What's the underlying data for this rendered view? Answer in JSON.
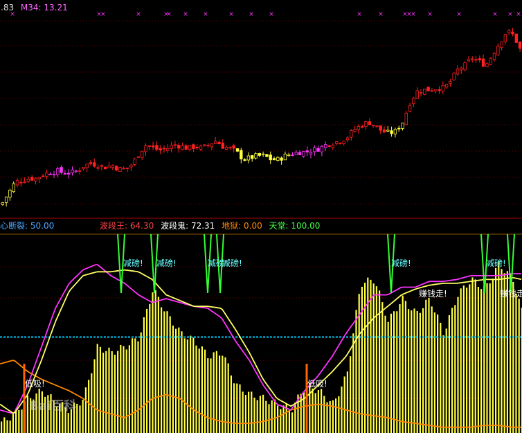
{
  "header_top": {
    "price_tail": ".83",
    "ma_label": "M34: 13.21"
  },
  "indicator_header": {
    "left_tail": "心断裂: 50.00",
    "items": [
      {
        "label": "波段王: 64.30",
        "color": "#ff4444"
      },
      {
        "label": "波段鬼: 72.31",
        "color": "#ffffff"
      },
      {
        "label": "地狱: 0.00",
        "color": "#ff8800"
      },
      {
        "label": "天堂: 100.00",
        "color": "#44ff44"
      }
    ],
    "left_color": "#4aa8ff"
  },
  "annotations": {
    "sell": "减磅!",
    "buy": "低吸!",
    "hold": "赚钱走!"
  },
  "watermark": "Bai百科",
  "colors": {
    "up": "#ff2020",
    "down": "#ff2020",
    "yellow": "#ffff40",
    "magenta": "#ff33ff",
    "orange": "#ff8800",
    "green": "#33ff33",
    "cyan": "#00ccff",
    "grid": "#7a0000"
  },
  "chart_data": [
    {
      "type": "candlestick",
      "ma_label": "M34: 13.21",
      "cross_markers_x": [
        18,
        143,
        149,
        200,
        240,
        244,
        268,
        297,
        334,
        363,
        392,
        519,
        550,
        585,
        591,
        597,
        621,
        663,
        715,
        737,
        749
      ],
      "close_series_x": [
        0,
        10,
        20,
        30,
        40,
        50,
        60,
        70,
        80,
        90,
        100,
        110,
        120,
        130,
        140,
        150,
        160,
        170,
        180,
        190,
        200,
        210,
        220,
        230,
        240,
        250,
        260,
        270,
        280,
        290,
        300,
        310,
        320,
        330,
        340,
        350,
        360,
        370,
        380,
        390,
        400,
        410,
        420,
        430,
        440,
        450,
        460,
        470,
        480,
        490,
        500,
        510,
        520,
        530,
        540,
        550,
        560,
        570,
        580,
        590,
        600,
        610,
        620,
        630,
        640,
        650,
        660,
        670,
        680,
        690,
        700,
        710,
        720,
        730,
        740,
        750
      ],
      "close_series_y": [
        9.9,
        10.2,
        10.5,
        10.55,
        10.6,
        10.6,
        10.7,
        10.75,
        10.8,
        10.75,
        10.75,
        10.8,
        10.95,
        11.0,
        10.95,
        10.9,
        10.95,
        10.85,
        10.85,
        11.0,
        11.3,
        11.5,
        11.4,
        11.35,
        11.4,
        11.5,
        11.45,
        11.4,
        11.45,
        11.4,
        11.5,
        11.6,
        11.45,
        11.4,
        11.3,
        11.1,
        11.15,
        11.2,
        11.2,
        11.1,
        11.1,
        11.2,
        11.25,
        11.3,
        11.3,
        11.35,
        11.4,
        11.5,
        11.55,
        11.6,
        11.7,
        11.9,
        12.0,
        12.1,
        12.0,
        11.85,
        11.8,
        11.85,
        12.1,
        12.6,
        12.9,
        12.95,
        12.95,
        13.0,
        13.0,
        13.2,
        13.5,
        13.6,
        13.8,
        13.7,
        13.6,
        13.9,
        14.2,
        14.5,
        14.4,
        14.0
      ]
    },
    {
      "type": "area",
      "series": [
        {
          "name": "波段王",
          "color": "magenta"
        },
        {
          "name": "波段鬼",
          "color": "yellow"
        },
        {
          "name": "地狱",
          "color": "orange"
        },
        {
          "name": "天堂",
          "color": "green"
        },
        {
          "name": "心断裂",
          "color": "cyan"
        }
      ],
      "ylim": [
        0,
        100
      ],
      "reference_line": 50,
      "x": [
        0,
        20,
        40,
        60,
        80,
        100,
        120,
        140,
        160,
        180,
        200,
        220,
        240,
        260,
        280,
        300,
        320,
        340,
        360,
        380,
        400,
        420,
        440,
        460,
        480,
        500,
        520,
        540,
        560,
        580,
        600,
        620,
        640,
        660,
        680,
        700,
        720,
        740,
        754
      ],
      "bars": [
        5,
        10,
        18,
        22,
        16,
        12,
        18,
        45,
        42,
        45,
        50,
        75,
        62,
        52,
        48,
        40,
        42,
        25,
        20,
        18,
        15,
        12,
        25,
        22,
        15,
        30,
        78,
        80,
        58,
        70,
        62,
        70,
        52,
        72,
        80,
        75,
        88,
        80,
        62
      ],
      "magenta_line": [
        12,
        10,
        25,
        45,
        65,
        78,
        85,
        88,
        82,
        78,
        72,
        68,
        70,
        68,
        66,
        65,
        60,
        48,
        38,
        25,
        15,
        12,
        22,
        30,
        40,
        52,
        62,
        72,
        72,
        76,
        76,
        79,
        79,
        80,
        82,
        82,
        82,
        83,
        83
      ],
      "yellow_line": [
        15,
        10,
        20,
        38,
        58,
        74,
        82,
        84,
        84,
        85,
        84,
        80,
        72,
        69,
        66,
        66,
        65,
        54,
        42,
        28,
        18,
        14,
        18,
        25,
        32,
        40,
        52,
        60,
        66,
        72,
        75,
        77,
        78,
        78,
        79,
        80,
        80,
        81,
        80
      ],
      "orange_line": [
        36,
        38,
        32,
        28,
        25,
        22,
        18,
        12,
        10,
        8,
        12,
        18,
        20,
        18,
        12,
        8,
        6,
        5,
        5,
        6,
        8,
        12,
        14,
        15,
        14,
        12,
        10,
        9,
        8,
        6,
        5,
        4,
        3,
        3,
        3,
        4,
        4,
        3,
        3
      ],
      "cyan_line": [
        50,
        50,
        50,
        50,
        50,
        50,
        50,
        50,
        50,
        50,
        50,
        50,
        50,
        50,
        50,
        50,
        50,
        50,
        50,
        50,
        50,
        50,
        50,
        50,
        50,
        50,
        50,
        50,
        50,
        50,
        50,
        50,
        50,
        50,
        50,
        50,
        50,
        50,
        50
      ]
    }
  ]
}
